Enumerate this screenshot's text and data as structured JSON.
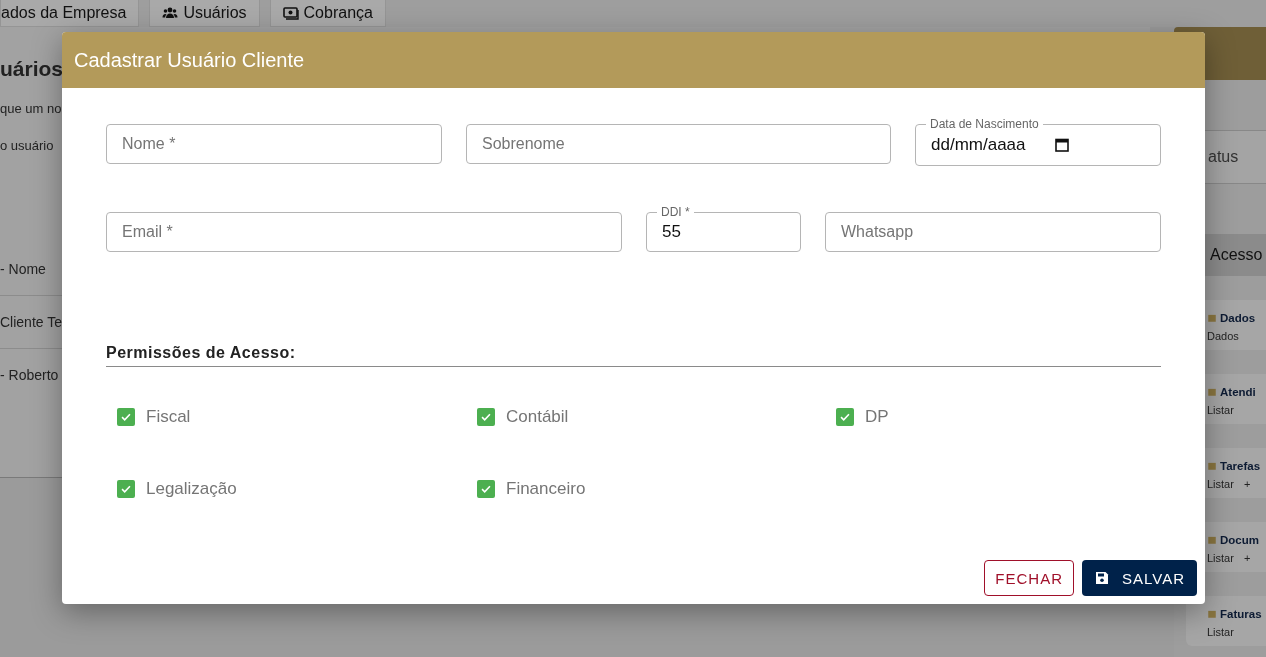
{
  "page_tabs": [
    {
      "label": "ados da Empresa"
    },
    {
      "label": "Usuários"
    },
    {
      "label": "Cobrança"
    }
  ],
  "users_panel": {
    "heading": "uários",
    "lines": [
      "que um no",
      "o usuário"
    ],
    "rows": [
      "- Nome",
      "Cliente Te",
      "- Roberto"
    ]
  },
  "side_panel": {
    "header_label": "atus",
    "section": "Acesso",
    "cards": [
      {
        "title": "Dados",
        "actions": [
          "Dados"
        ]
      },
      {
        "title": "Atendi",
        "actions": [
          "Listar"
        ]
      },
      {
        "title": "Tarefas",
        "actions": [
          "Listar",
          "+"
        ]
      },
      {
        "title": "Docum",
        "actions": [
          "Listar",
          "+"
        ]
      },
      {
        "title": "Faturas",
        "actions": [
          "Listar"
        ]
      }
    ]
  },
  "dialog": {
    "title": "Cadastrar Usuário Cliente",
    "field_rows": [
      [
        {
          "kind": "text",
          "placeholder": "Nome *"
        },
        {
          "kind": "text",
          "placeholder": "Sobrenome"
        },
        {
          "kind": "date",
          "label": "Data de Nascimento",
          "value": "dd/mm/aaaa"
        }
      ],
      [
        {
          "kind": "text",
          "placeholder": "Email *"
        },
        {
          "kind": "labeled",
          "label": "DDI *",
          "value": "55"
        },
        {
          "kind": "text",
          "placeholder": "Whatsapp"
        }
      ]
    ],
    "permissions_title": "Permissões de Acesso:",
    "permissions": [
      {
        "label": "Fiscal",
        "checked": true
      },
      {
        "label": "Contábil",
        "checked": true
      },
      {
        "label": "DP",
        "checked": true
      },
      {
        "label": "Legalização",
        "checked": true
      },
      {
        "label": "Financeiro",
        "checked": true
      }
    ],
    "buttons": [
      {
        "kind": "outline",
        "label": "FECHAR"
      },
      {
        "kind": "primary",
        "label": "SALVAR"
      }
    ]
  }
}
